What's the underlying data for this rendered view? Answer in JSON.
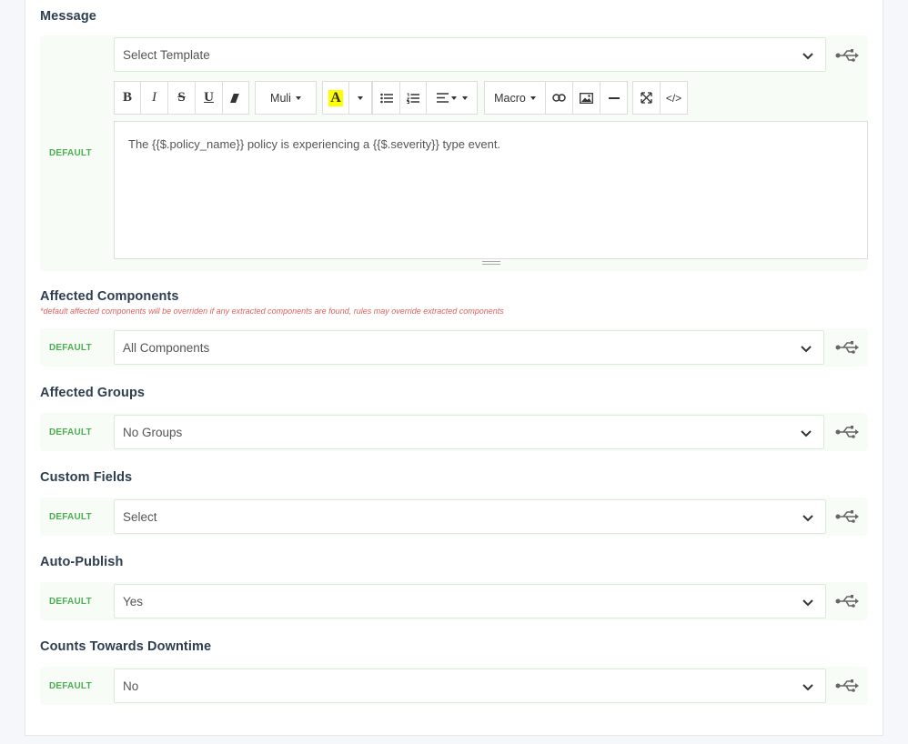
{
  "message": {
    "title": "Message",
    "default_label": "DEFAULT",
    "template_select": "Select Template",
    "toolbar": {
      "bold": "B",
      "italic": "I",
      "strike": "S",
      "underline": "U",
      "font": "Muli",
      "highlight": "A",
      "macro": "Macro",
      "code": "</>"
    },
    "body": "The {{$.policy_name}} policy is experiencing a {{$.severity}} type event."
  },
  "affected_components": {
    "title": "Affected Components",
    "note": "*default affected components will be overriden if any extracted components are found, rules may override extracted components",
    "default_label": "DEFAULT",
    "value": "All Components"
  },
  "affected_groups": {
    "title": "Affected Groups",
    "default_label": "DEFAULT",
    "value": "No Groups"
  },
  "custom_fields": {
    "title": "Custom Fields",
    "default_label": "DEFAULT",
    "value": "Select"
  },
  "auto_publish": {
    "title": "Auto-Publish",
    "default_label": "DEFAULT",
    "value": "Yes"
  },
  "counts_downtime": {
    "title": "Counts Towards Downtime",
    "default_label": "DEFAULT",
    "value": "No"
  },
  "colors": {
    "default_green": "#4caf50",
    "title": "#2c3e50",
    "note_red": "#e06060",
    "highlight_yellow": "#ffff00"
  }
}
